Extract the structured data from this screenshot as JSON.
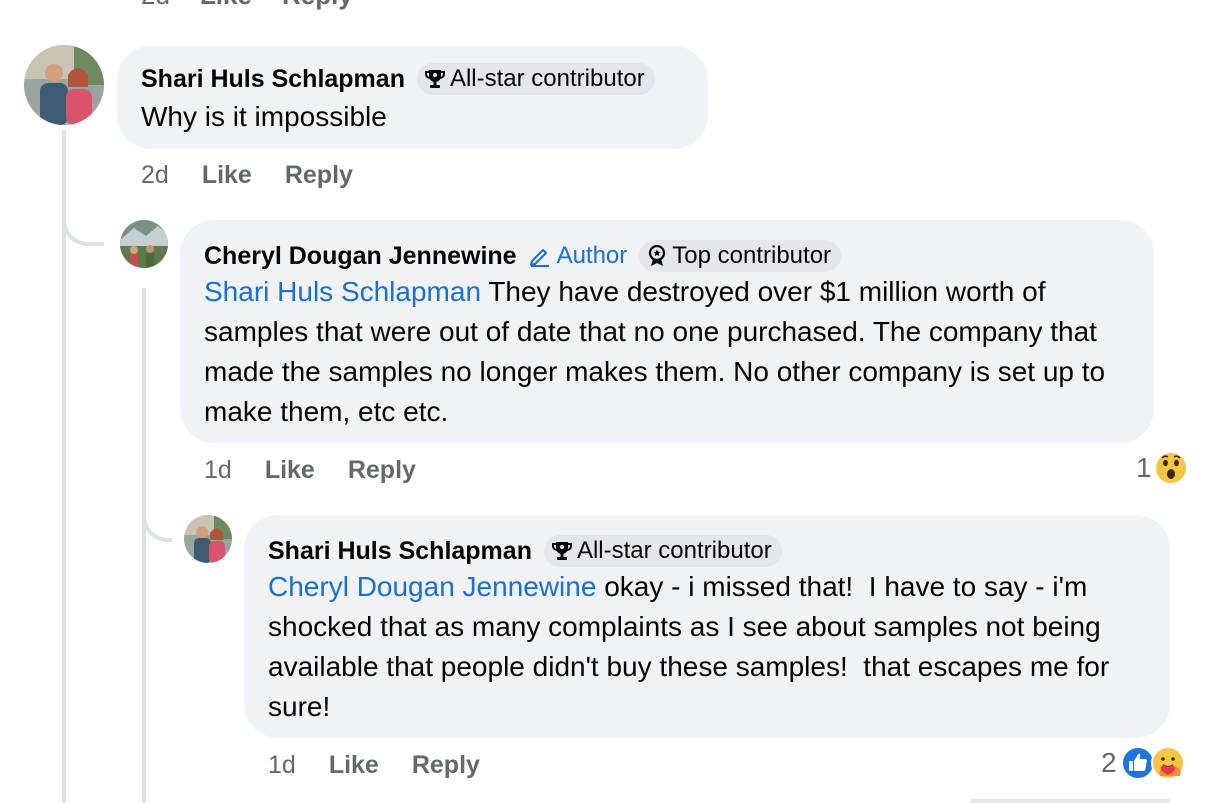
{
  "previous_comment": {
    "time": "2d",
    "like": "Like",
    "reply": "Reply"
  },
  "comment1": {
    "author": "Shari Huls Schlapman",
    "badge": "All-star contributor",
    "text": "Why is it impossible",
    "time": "2d",
    "like": "Like",
    "reply": "Reply"
  },
  "comment2": {
    "author": "Cheryl Dougan Jennewine",
    "author_badge": "Author",
    "badge": "Top contributor",
    "mention": "Shari Huls Schlapman",
    "text": " They have destroyed over $1 million worth of samples that were out of date that no one purchased. The company that made the samples no longer makes them. No other company is set up to make them, etc etc.",
    "time": "1d",
    "like": "Like",
    "reply": "Reply",
    "reaction_count": "1",
    "reaction_icons": [
      "wow-icon"
    ]
  },
  "comment3": {
    "author": "Shari Huls Schlapman",
    "badge": "All-star contributor",
    "mention": "Cheryl Dougan Jennewine",
    "text": " okay - i missed that!  I have to say - i'm shocked that as many complaints as I see about samples not being available that people didn't buy these samples!  that escapes me for sure!",
    "time": "1d",
    "like": "Like",
    "reply": "Reply",
    "reaction_count": "2",
    "reaction_icons": [
      "like-icon",
      "care-icon"
    ]
  },
  "colors": {
    "link": "#1a6fd6",
    "bubble": "#f0f2f5",
    "meta": "#65676b",
    "thread_line": "#dfe1e5"
  }
}
